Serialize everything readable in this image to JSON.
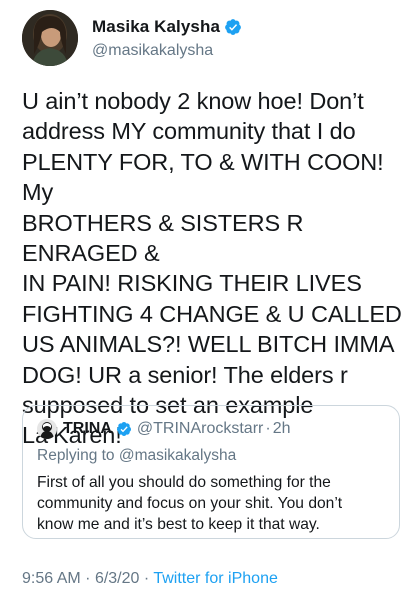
{
  "tweet": {
    "author": {
      "display_name": "Masika Kalysha",
      "handle": "@masikakalysha",
      "verified": true
    },
    "text": "U ain’t nobody 2 know hoe! Don’t\naddress MY community that I do\nPLENTY FOR, TO & WITH COON! My\nBROTHERS & SISTERS R ENRAGED &\nIN PAIN! RISKING THEIR LIVES\nFIGHTING 4 CHANGE & U CALLED\nUS ANIMALS?! WELL BITCH IMMA\nDOG! UR a senior! The elders r\nsupposed to set an example La’Karen!",
    "quoted": {
      "display_name": "TRINA",
      "handle": "@TRINArockstarr",
      "separator": "·",
      "time": "2h",
      "replying_to": "Replying to @masikakalysha",
      "text": "First of all you should do something for the\ncommunity and focus on your shit. You don’t\nknow me and it’s best to keep it that way."
    },
    "meta": {
      "time": "9:56 AM",
      "separator": "·",
      "date": "6/3/20",
      "source": "Twitter for iPhone"
    }
  },
  "colors": {
    "text": "#14171a",
    "secondary": "#657786",
    "link": "#1da1f2",
    "border": "#ccd6dd"
  },
  "icons": {
    "verified": "verified-badge-icon"
  }
}
